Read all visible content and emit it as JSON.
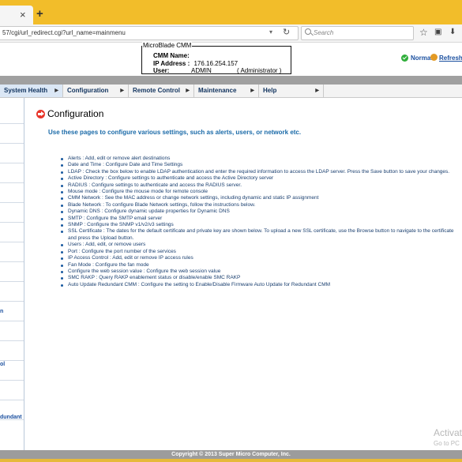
{
  "browser": {
    "tab_close": "×",
    "new_tab": "+",
    "url": "57/cgi/url_redirect.cgi?url_name=mainmenu",
    "search_placeholder": "Search",
    "reload_icon": "↻",
    "dropdown_icon": "▾",
    "star_icon": "☆",
    "bookmark_icon": "▣",
    "download_icon": "⬇"
  },
  "header": {
    "box_title": "MicroBlade CMM",
    "name_label": "CMM Name:",
    "ip_label": "IP Address :",
    "ip_value": "176.16.254.157",
    "user_label": "User:",
    "user_value": "ADMIN",
    "user_role": "( Administrator )",
    "status": "Normal",
    "refresh": "Refresh"
  },
  "menu": [
    {
      "label": "System Health"
    },
    {
      "label": "Configuration"
    },
    {
      "label": "Remote Control"
    },
    {
      "label": "Maintenance"
    },
    {
      "label": "Help"
    }
  ],
  "sidebar": {
    "labels": [
      "n",
      "ol",
      "dundant"
    ]
  },
  "page": {
    "title": "Configuration",
    "intro": "Use these pages to configure various settings, such as alerts, users, or network etc.",
    "items": [
      "Alerts : Add, edit or remove alert destinations",
      "Date and Time : Configure Date and Time Settings",
      "LDAP : Check the box below to enable LDAP authentication and enter the required information to access the LDAP server. Press the Save button to save your changes.",
      "Active Directory : Configure settings to authenticate and access the Active Directory server",
      "RADIUS : Configure settings to authenticate and access the RADIUS server.",
      "Mouse mode : Configure the mouse mode for remote console",
      "CMM Network : See the MAC address or change network settings, including dynamic and static IP assignment",
      "Blade Network : To configure Blade Network settings, follow the instructions below.",
      "Dynamic DNS : Configure dynamic update properties for Dynamic DNS",
      "SMTP : Configure the SMTP email server",
      "SNMP : Configure the SNMP v1/v2/v3 settings",
      "SSL Certificate : The dates for the default certificate and private key are shown below. To upload a new SSL certificate, use the Browse button to navigate to the certificate and press the Upload button.",
      "Users : Add, edit, or remove users",
      "Port : Configure the port number of the services",
      "IP Access Control : Add, edit or remove IP access rules",
      "Fan Mode : Configure the fan mode",
      "Configure the web session value : Configure the web session value",
      "SMC RAKP : Query RAKP enablement status or disable/enable SMC RAKP",
      "Auto Update Redundant CMM : Configure the setting to Enable/Disable Firmware Auto Update for Redundant CMM"
    ]
  },
  "watermark": {
    "line1": "Activat",
    "line2": "Go to PC"
  },
  "footer": "Copyright © 2013 Super Micro Computer, Inc."
}
